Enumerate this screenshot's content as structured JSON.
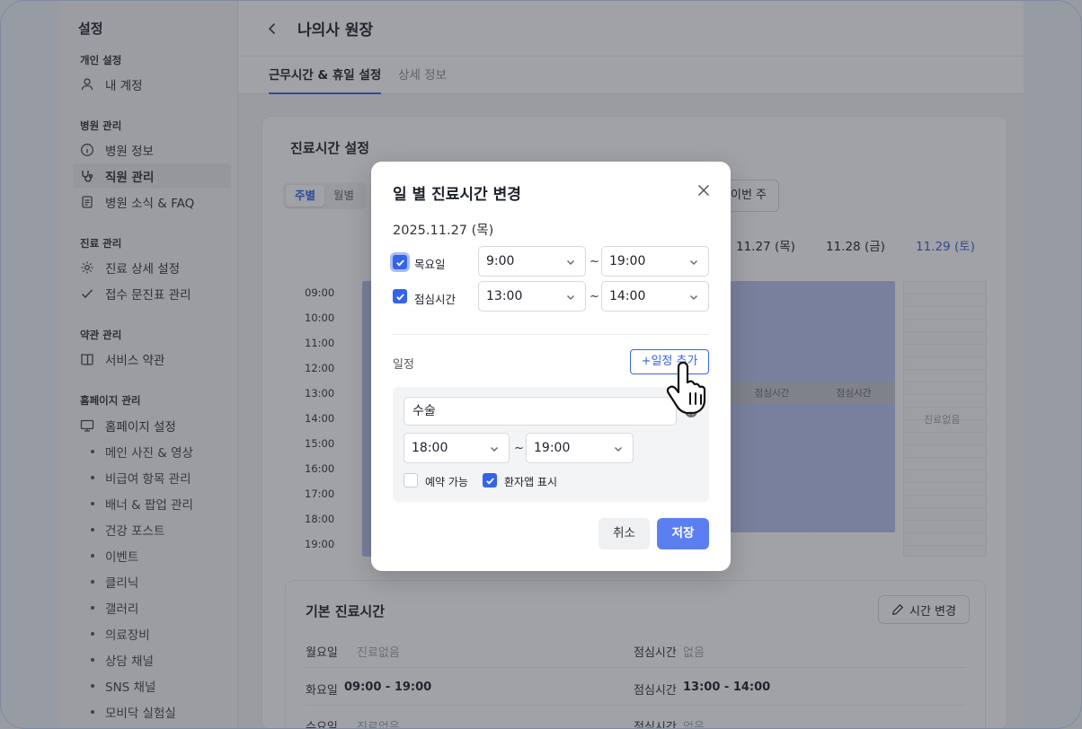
{
  "sidebar": {
    "title": "설정",
    "sections": [
      {
        "label": "개인 설정"
      },
      {
        "label": "병원 관리"
      },
      {
        "label": "진료 관리"
      },
      {
        "label": "약관 관리"
      },
      {
        "label": "홈페이지 관리"
      }
    ],
    "items": [
      {
        "label": "내 계정",
        "icon": "user-icon"
      },
      {
        "label": "병원 정보",
        "icon": "info-icon"
      },
      {
        "label": "직원 관리",
        "icon": "stethoscope-icon"
      },
      {
        "label": "병원 소식 & FAQ",
        "icon": "document-icon"
      },
      {
        "label": "진료 상세 설정",
        "icon": "gear-icon"
      },
      {
        "label": "접수 문진표 관리",
        "icon": "check-icon"
      },
      {
        "label": "서비스 약관",
        "icon": "book-icon"
      },
      {
        "label": "홈페이지 설정",
        "icon": "monitor-icon"
      }
    ],
    "subitems": [
      "메인 사진 & 영상",
      "비급여 항목 관리",
      "배너 & 팝업 관리",
      "건강 포스트",
      "이벤트",
      "클리닉",
      "갤러리",
      "의료장비",
      "상담 채널",
      "SNS 채널",
      "모비닥 실험실"
    ]
  },
  "header": {
    "title": "나의사 원장"
  },
  "tabs": [
    "근무시간 & 휴일 설정",
    "상세 정보"
  ],
  "schedule": {
    "title": "진료시간 설정",
    "view_options": [
      "주별",
      "월별"
    ],
    "this_week": "이번 주",
    "days": [
      "11.27 (목)",
      "11.28 (금)",
      "11.29 (토)"
    ],
    "hours": [
      "09:00",
      "10:00",
      "11:00",
      "12:00",
      "13:00",
      "14:00",
      "15:00",
      "16:00",
      "17:00",
      "18:00",
      "19:00"
    ],
    "lunch_label": "점심시간",
    "empty_label": "진료없음"
  },
  "base_hours": {
    "title": "기본 진료시간",
    "edit_label": "시간 변경",
    "rows": [
      {
        "day": "월요일",
        "hours": "진료없음",
        "lunch_label": "점심시간",
        "lunch": "없음"
      },
      {
        "day": "화요일",
        "hours": "09:00 - 19:00",
        "lunch_label": "점심시간",
        "lunch": "13:00 - 14:00"
      },
      {
        "day": "수요일",
        "hours": "진료없음",
        "lunch_label": "점심시간",
        "lunch": "없음"
      }
    ]
  },
  "modal": {
    "title": "일 별 진료시간 변경",
    "date": "2025.11.27 (목)",
    "work_label": "목요일",
    "work_start": "9:00",
    "work_end": "19:00",
    "lunch_label": "점심시간",
    "lunch_start": "13:00",
    "lunch_end": "14:00",
    "tilde": "~",
    "schedule_label": "일정",
    "add_label": "+일정 추가",
    "event_name": "수술",
    "event_start": "18:00",
    "event_end": "19:00",
    "reservable_label": "예약 가능",
    "reservable": false,
    "show_app_label": "환자앱 표시",
    "show_app": true,
    "cancel_label": "취소",
    "save_label": "저장"
  },
  "colors": {
    "accent": "#3563e9",
    "save": "#5b7ff0",
    "slot": "#b7c2ef"
  }
}
